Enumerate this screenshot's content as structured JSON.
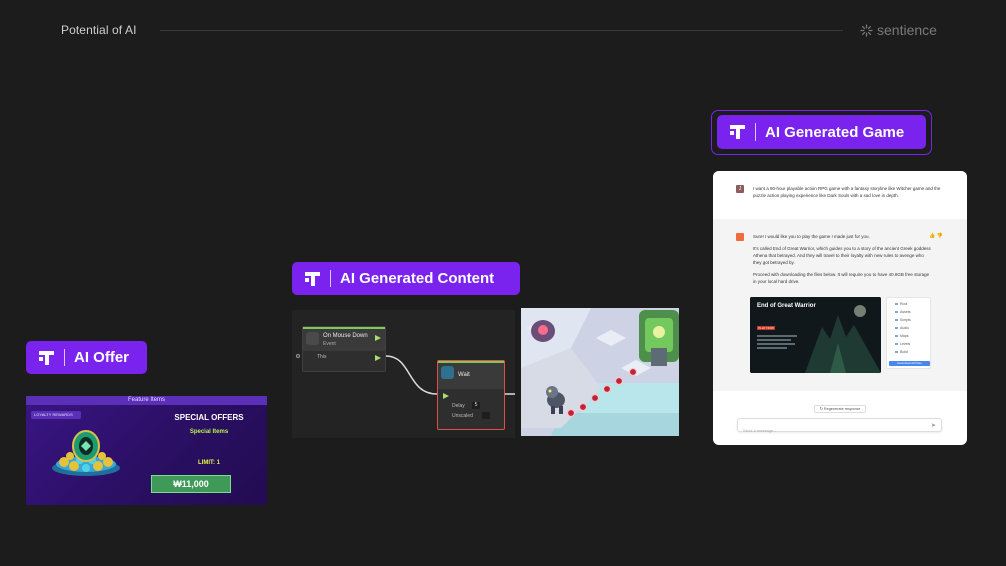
{
  "header": {
    "title": "Potential of AI",
    "brand": "sentience",
    "brand_icon": "sentience-logo-icon"
  },
  "colors": {
    "background": "#1c1c1c",
    "accent": "#7a22ee"
  },
  "cards": {
    "offer": {
      "label": "AI Offer",
      "top_bar": "Feature Items",
      "tag": "LOYALTY REWARDS",
      "title": "SPECIAL OFFERS",
      "subtitle": "Special Items",
      "limit": "LIMIT: 1",
      "price": "₩11,000"
    },
    "content": {
      "label": "AI Generated Content",
      "node1": {
        "title": "On Mouse Down",
        "subtitle": "Event",
        "row": "This"
      },
      "node2": {
        "title": "Wait",
        "delay_label": "Delay",
        "delay_value": "5",
        "unscaled_label": "Unscaled"
      }
    },
    "game": {
      "label": "AI Generated Game",
      "user_prompt": "I want a 90-hour playable action RPG game with a fantasy storyline like Witcher game and the puzzle action playing experience like Dark Souls with a sad love in depth.",
      "bot_reply_1": "Sure! I would like you to play the game I made just for you.",
      "bot_reply_2": "It's called End of Great Warrior, which guides you to a story of the ancient Greek goddess Athena that betrayed. And they will travel to their loyalty with new rules to avenge who they got betrayed by.",
      "bot_reply_3": "Proceed with downloading the files below. It will require you to have 40.8GB free storage in your local hard drive.",
      "game_card_title": "End of Great Warrior",
      "game_card_button": "PLAY NOW",
      "files": [
        "Root",
        "Assets",
        "Scripts",
        "Audio",
        "Maps",
        "Levels",
        "Build"
      ],
      "download_button": "Download All Files",
      "regenerate": "↻ Regenerate response",
      "input_placeholder": "Send a message...",
      "send_icon": "send-icon"
    }
  }
}
